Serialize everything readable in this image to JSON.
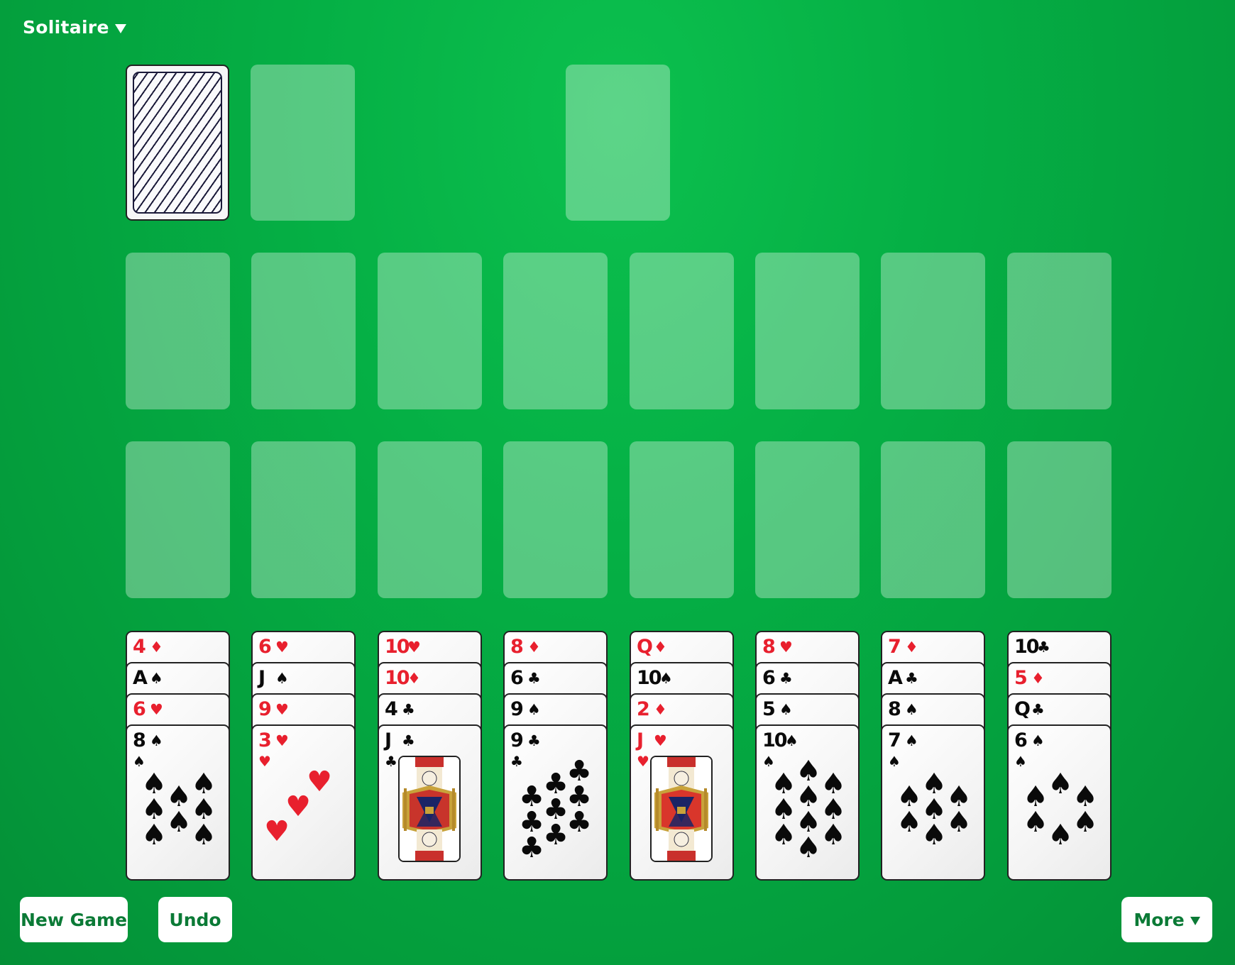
{
  "app": {
    "title": "Solitaire",
    "title_menu_icon": "triangle-down-icon"
  },
  "colors": {
    "felt": "#05b045",
    "button_text": "#0b7a36",
    "red_suit": "#e8202e",
    "black_suit": "#0a0a0a"
  },
  "top_row": {
    "stock": {
      "face_down": true,
      "back_pattern": "diagonal-stripes"
    },
    "waste": {
      "empty": true
    },
    "extra_slot": {
      "empty": true
    }
  },
  "slot_rows": [
    {
      "row": 1,
      "slots": 8,
      "empty": true
    },
    {
      "row": 2,
      "slots": 8,
      "empty": true
    }
  ],
  "tableau": [
    {
      "cards": [
        {
          "rank": "4",
          "suit": "♦"
        },
        {
          "rank": "A",
          "suit": "♠"
        },
        {
          "rank": "6",
          "suit": "♥"
        },
        {
          "rank": "8",
          "suit": "♠"
        }
      ]
    },
    {
      "cards": [
        {
          "rank": "6",
          "suit": "♥"
        },
        {
          "rank": "J",
          "suit": "♠"
        },
        {
          "rank": "9",
          "suit": "♥"
        },
        {
          "rank": "3",
          "suit": "♥"
        }
      ]
    },
    {
      "cards": [
        {
          "rank": "10",
          "suit": "♥"
        },
        {
          "rank": "10",
          "suit": "♦"
        },
        {
          "rank": "4",
          "suit": "♣"
        },
        {
          "rank": "J",
          "suit": "♣"
        }
      ]
    },
    {
      "cards": [
        {
          "rank": "8",
          "suit": "♦"
        },
        {
          "rank": "6",
          "suit": "♣"
        },
        {
          "rank": "9",
          "suit": "♠"
        },
        {
          "rank": "9",
          "suit": "♣"
        }
      ]
    },
    {
      "cards": [
        {
          "rank": "Q",
          "suit": "♦"
        },
        {
          "rank": "10",
          "suit": "♠"
        },
        {
          "rank": "2",
          "suit": "♦"
        },
        {
          "rank": "J",
          "suit": "♥"
        }
      ]
    },
    {
      "cards": [
        {
          "rank": "8",
          "suit": "♥"
        },
        {
          "rank": "6",
          "suit": "♣"
        },
        {
          "rank": "5",
          "suit": "♠"
        },
        {
          "rank": "10",
          "suit": "♠"
        }
      ]
    },
    {
      "cards": [
        {
          "rank": "7",
          "suit": "♦"
        },
        {
          "rank": "A",
          "suit": "♣"
        },
        {
          "rank": "8",
          "suit": "♠"
        },
        {
          "rank": "7",
          "suit": "♠"
        }
      ]
    },
    {
      "cards": [
        {
          "rank": "10",
          "suit": "♣"
        },
        {
          "rank": "5",
          "suit": "♦"
        },
        {
          "rank": "Q",
          "suit": "♣"
        },
        {
          "rank": "6",
          "suit": "♠"
        }
      ]
    }
  ],
  "buttons": {
    "new_game": "New Game",
    "undo": "Undo",
    "more": "More",
    "more_icon": "triangle-down-icon"
  }
}
